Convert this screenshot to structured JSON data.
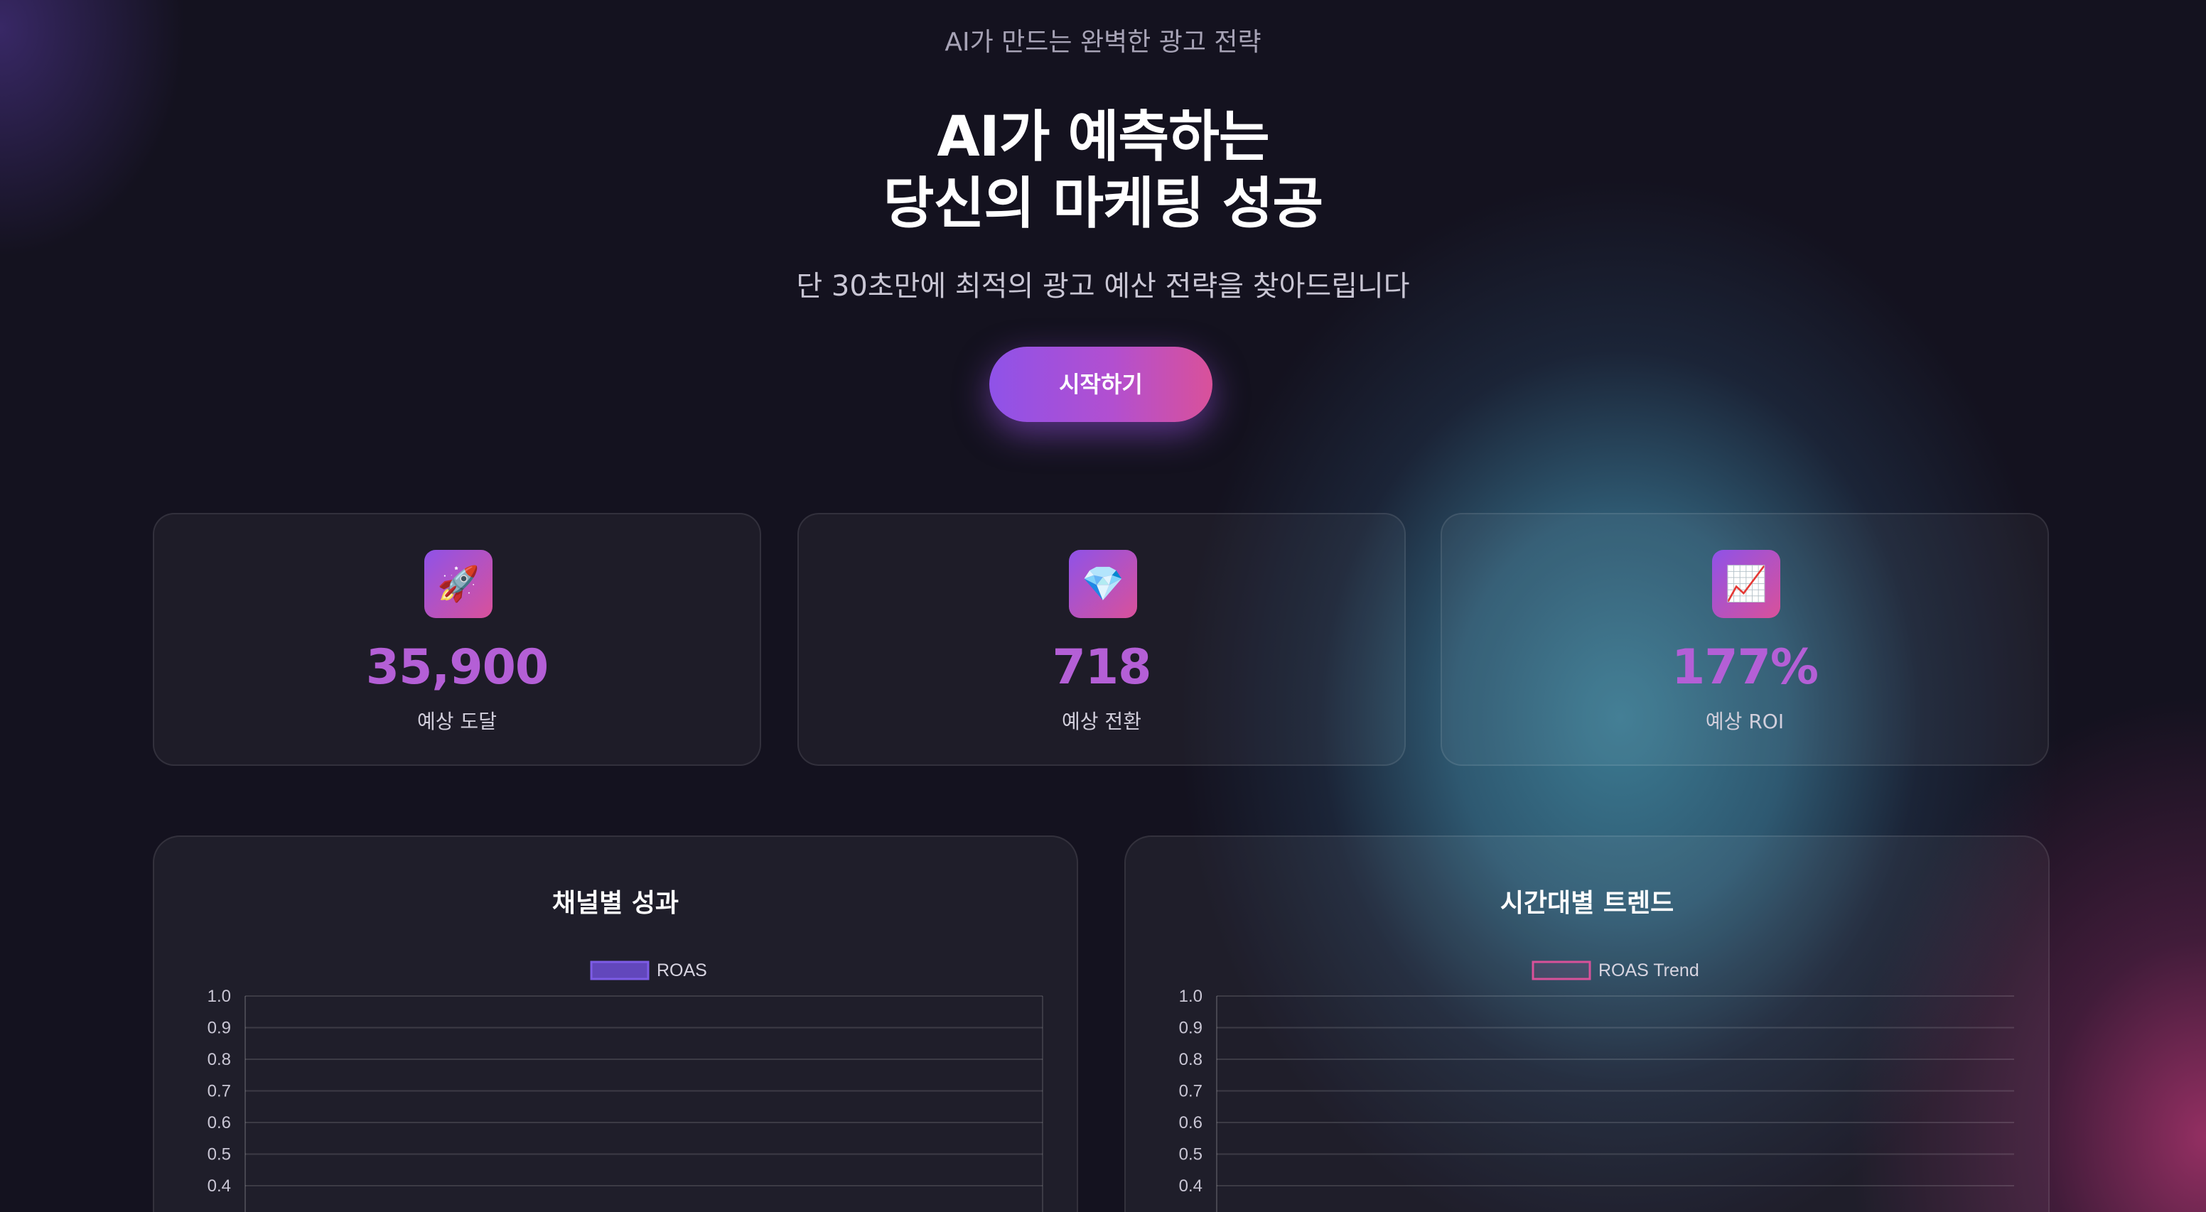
{
  "hero": {
    "eyebrow": "AI가 만드는 완벽한 광고 전략",
    "title_line1": "AI가 예측하는",
    "title_line2": "당신의 마케팅 성공",
    "subtitle": "단 30초만에 최적의 광고 예산 전략을 찾아드립니다",
    "cta_label": "시작하기"
  },
  "stats": [
    {
      "icon": "rocket-icon",
      "glyph": "🚀",
      "value": "35,900",
      "label": "예상 도달"
    },
    {
      "icon": "gem-icon",
      "glyph": "💎",
      "value": "718",
      "label": "예상 전환"
    },
    {
      "icon": "chart-increasing-icon",
      "glyph": "📈",
      "value": "177%",
      "label": "예상 ROI"
    }
  ],
  "colors": {
    "accent_purple": "#8f52e8",
    "accent_pink": "#d9519a",
    "stat_value": "#b45fd6",
    "background": "#14121f"
  },
  "chart_data": [
    {
      "type": "bar",
      "title": "채널별 성과",
      "series": [
        {
          "name": "ROAS",
          "values": [],
          "color": "#6f4fd6"
        }
      ],
      "categories": [],
      "yticks": [
        "1.0",
        "0.9",
        "0.8",
        "0.7",
        "0.6",
        "0.5",
        "0.4"
      ],
      "ylim": [
        0,
        1.0
      ],
      "grid": true,
      "legend": "top"
    },
    {
      "type": "line",
      "title": "시간대별 트렌드",
      "series": [
        {
          "name": "ROAS Trend",
          "values": [],
          "color": "#d9519a"
        }
      ],
      "categories": [],
      "yticks": [
        "1.0",
        "0.9",
        "0.8",
        "0.7",
        "0.6",
        "0.5",
        "0.4"
      ],
      "ylim": [
        0,
        1.0
      ],
      "grid": true,
      "legend": "top"
    }
  ]
}
